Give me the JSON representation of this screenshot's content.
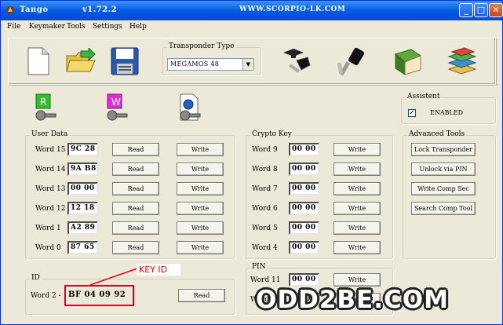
{
  "titlebar": {
    "title": "Tango",
    "version": "v1.72.2",
    "site": "WWW.SCORPIO-LK.COM"
  },
  "menu": [
    "File",
    "Keymaker",
    "Tools",
    "Settings",
    "Help"
  ],
  "transponder": {
    "label": "Transponder Type",
    "value": "MEGAMOS 48"
  },
  "assistant": {
    "label": "Assistent",
    "checkbox_label": "ENABLED",
    "checked": true
  },
  "user_data": {
    "label": "User Data",
    "read_label": "Read",
    "write_label": "Write",
    "rows": [
      {
        "label": "Word 15",
        "value": "9C 28"
      },
      {
        "label": "Word 14",
        "value": "9A B8"
      },
      {
        "label": "Word 13",
        "value": "00 00"
      },
      {
        "label": "Word 12",
        "value": "12 18"
      },
      {
        "label": "Word  1",
        "value": "A2 89"
      },
      {
        "label": "Word  0",
        "value": "87 65"
      }
    ]
  },
  "crypto_key": {
    "label": "Crypto Key",
    "write_label": "Write",
    "rows": [
      {
        "label": "Word  9",
        "value": "00 00"
      },
      {
        "label": "Word  8",
        "value": "00 00"
      },
      {
        "label": "Word  7",
        "value": "00 00"
      },
      {
        "label": "Word  6",
        "value": "00 00"
      },
      {
        "label": "Word  5",
        "value": "00 00"
      },
      {
        "label": "Word  4",
        "value": "00 00"
      }
    ]
  },
  "advanced_tools": {
    "label": "Advanced Tools",
    "buttons": [
      "Lock Transponder",
      "Unlock via PIN",
      "Write Comp Sec",
      "Search Comp Tool"
    ]
  },
  "id_group": {
    "label": "ID",
    "row_label": "Word  2 -",
    "value": "BF 04 09 92",
    "read_label": "Read"
  },
  "pin_group": {
    "label": "PIN",
    "write_label": "Write",
    "rows": [
      {
        "label": "Word 11",
        "value": "00 00"
      },
      {
        "label": "Word 10",
        "value": "00 00"
      }
    ]
  },
  "annotation": {
    "text": "KEY ID",
    "color": "#ff0000"
  },
  "watermark": "ODD2BE.COM",
  "colors": {
    "titlebar": "#0a5fe4",
    "window_bg": "#ece9d8",
    "highlight_red": "#e0001b"
  }
}
